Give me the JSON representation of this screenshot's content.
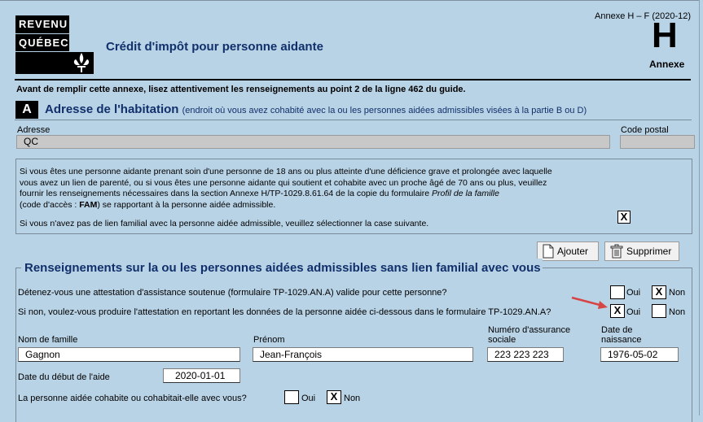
{
  "header": {
    "logo_line1": "REVENU",
    "logo_line2": "QUÉBEC",
    "title": "Crédit d'impôt pour personne aidante",
    "annexe_ref": "Annexe H – F (2020-12)",
    "annexe_letter": "H",
    "annexe_label": "Annexe"
  },
  "intro": "Avant de remplir cette annexe, lisez attentivement les renseignements au point 2 de la ligne 462 du guide.",
  "section_a": {
    "letter": "A",
    "title": "Adresse de l'habitation",
    "subtitle": "(endroit où vous avez cohabité avec la ou les personnes aidées admissibles visées à la partie B ou D)",
    "address_label": "Adresse",
    "address_value": "QC",
    "postal_label": "Code postal",
    "postal_value": ""
  },
  "info_panel": {
    "line1": "Si vous êtes une personne aidante prenant soin d'une personne de 18 ans ou plus atteinte d'une déficience grave et prolongée avec laquelle",
    "line2": "vous avez un lien de parenté, ou si vous êtes une personne aidante qui soutient et cohabite avec un proche âgé de 70 ans ou plus, veuillez",
    "line3_a": "fournir les renseignements nécessaires dans la section Annexe H/TP-1029.8.61.64 de la copie du formulaire ",
    "line3_b": "Profil de la famille",
    "line4_a": "(code d'accès : ",
    "line4_b": "FAM",
    "line4_c": ") se rapportant à la personne aidée admissible.",
    "no_link_text": "Si vous n'avez pas de lien familial avec la personne aidée admissible, veuillez sélectionner la case suivante.",
    "no_link_checked": "X"
  },
  "buttons": {
    "add": "Ajouter",
    "delete": "Supprimer"
  },
  "section_2": {
    "title": "Renseignements sur la ou les personnes aidées admissibles sans lien familial avec vous",
    "q1": "Détenez-vous une attestation d'assistance soutenue (formulaire TP-1029.AN.A) valide pour cette personne?",
    "q1_oui": "",
    "q1_non": "X",
    "q2": "Si non, voulez-vous produire l'attestation en reportant les données de la personne aidée ci-dessous dans le formulaire TP-1029.AN.A?",
    "q2_oui": "X",
    "q2_non": "",
    "oui_label": "Oui",
    "non_label": "Non",
    "family_name_label": "Nom de famille",
    "family_name": "Gagnon",
    "first_name_label": "Prénom",
    "first_name": "Jean-François",
    "sin_label_1": "Numéro d'assurance",
    "sin_label_2": "sociale",
    "sin": "223 223 223",
    "birth_label_1": "Date de",
    "birth_label_2": "naissance",
    "birth": "1976-05-02",
    "start_label": "Date du début de l'aide",
    "start_date": "2020-01-01",
    "q3": "La personne aidée cohabite ou cohabitait-elle avec vous?",
    "q3_oui": "",
    "q3_non": "X"
  },
  "colors": {
    "background": "#b9d3e6",
    "title_blue": "#11306b",
    "arrow_red": "#d64545"
  },
  "icons": [
    "fleur-de-lis-icon",
    "document-icon",
    "trash-icon",
    "red-arrow-icon"
  ]
}
